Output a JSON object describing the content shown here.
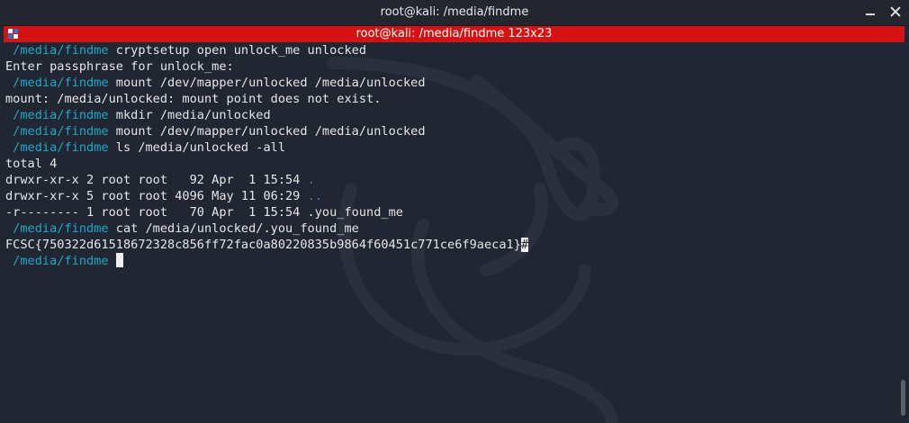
{
  "window": {
    "title": "root@kali: /media/findme"
  },
  "tab": {
    "title": "root@kali: /media/findme 123x23"
  },
  "terminal": {
    "lines": [
      {
        "prompt": " /media/findme ",
        "text": "cryptsetup open unlock_me unlocked"
      },
      {
        "text": "Enter passphrase for unlock_me:"
      },
      {
        "prompt": " /media/findme ",
        "text": "mount /dev/mapper/unlocked /media/unlocked"
      },
      {
        "text": "mount: /media/unlocked: mount point does not exist."
      },
      {
        "prompt": " /media/findme ",
        "text": "mkdir /media/unlocked"
      },
      {
        "prompt": " /media/findme ",
        "text": "mount /dev/mapper/unlocked /media/unlocked"
      },
      {
        "prompt": " /media/findme ",
        "text": "ls /media/unlocked -all"
      },
      {
        "text": "total 4"
      },
      {
        "text": "drwxr-xr-x 2 root root   92 Apr  1 15:54 ",
        "link": "."
      },
      {
        "text": "drwxr-xr-x 5 root root 4096 May 11 06:29 ",
        "link": ".."
      },
      {
        "text": "-r-------- 1 root root   70 Apr  1 15:54 .you_found_me"
      },
      {
        "prompt": " /media/findme ",
        "text": "cat /media/unlocked/.you_found_me"
      },
      {
        "text": "FCSC{750322d61518672328c856ff72fac0a80220835b9864f60451c771ce6f9aeca1}",
        "trail": "#"
      },
      {
        "prompt": " /media/findme ",
        "text": " "
      }
    ]
  },
  "colors": {
    "background": "#202632",
    "tab_active": "#d41213",
    "prompt": "#1fa9c4",
    "directory": "#3f7cd6",
    "text": "#e6e6e6"
  },
  "icons": {
    "tab": "terminal-tab-icon",
    "minimize": "minimize-icon",
    "close": "close-icon"
  }
}
